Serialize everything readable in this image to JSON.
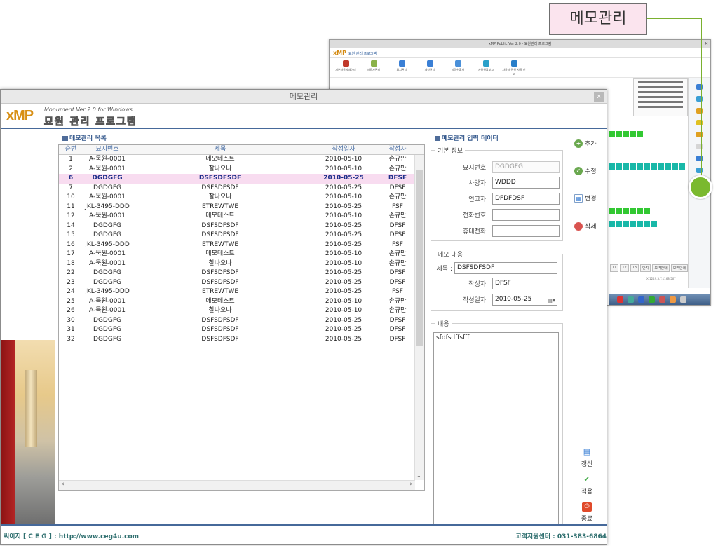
{
  "callout": {
    "label": "메모관리"
  },
  "bg_window": {
    "title": "xMP Public Ver 2.0 - 묘원관리 프로그램",
    "logo": "xMP",
    "logo_sub": "묘원 관리 프로그램",
    "toolbar": [
      {
        "label": "기본사용자데이터",
        "color": "#c0392b"
      },
      {
        "label": "사용자관리",
        "color": "#8bb24a"
      },
      {
        "label": "묘지관리",
        "color": "#3a7fd5"
      },
      {
        "label": "계약관리",
        "color": "#3a7fd5"
      },
      {
        "label": "지정현황서",
        "color": "#4a90d9"
      },
      {
        "label": "사용현황보고",
        "color": "#2aa0c9"
      },
      {
        "label": "사용자 권한 사용 신고",
        "color": "#2a7fc9"
      }
    ],
    "pager": [
      "11",
      "12",
      "13",
      "단지",
      "묘역안내",
      "묘역안내"
    ],
    "coord": "X:1249.3,Y:1168.567"
  },
  "window": {
    "title": "메모관리",
    "close": "x",
    "logo_x": "xMP",
    "logo_small": "Monument Ver 2.0 for Windows",
    "logo_name": "묘원 관리 프로그램"
  },
  "list": {
    "title": "메모관리 목록",
    "headers": [
      "순번",
      "묘지번호",
      "제목",
      "작성일자",
      "작성자"
    ],
    "rows": [
      [
        "1",
        "A-묵원-0001",
        "메모테스트",
        "2010-05-10",
        "손규만"
      ],
      [
        "2",
        "A-묵원-0001",
        "찰나오나",
        "2010-05-10",
        "손규만"
      ],
      [
        "6",
        "DGDGFG",
        "DSFSDFSDF",
        "2010-05-25",
        "DFSF"
      ],
      [
        "7",
        "DGDGFG",
        "DSFSDFSDF",
        "2010-05-25",
        "DFSF"
      ],
      [
        "10",
        "A-묵원-0001",
        "찰나오나",
        "2010-05-10",
        "손규만"
      ],
      [
        "11",
        "JKL-3495-DDD",
        "ETREWTWE",
        "2010-05-25",
        "FSF"
      ],
      [
        "12",
        "A-묵원-0001",
        "메모테스트",
        "2010-05-10",
        "손규만"
      ],
      [
        "14",
        "DGDGFG",
        "DSFSDFSDF",
        "2010-05-25",
        "DFSF"
      ],
      [
        "15",
        "DGDGFG",
        "DSFSDFSDF",
        "2010-05-25",
        "DFSF"
      ],
      [
        "16",
        "JKL-3495-DDD",
        "ETREWTWE",
        "2010-05-25",
        "FSF"
      ],
      [
        "17",
        "A-묵원-0001",
        "메모테스트",
        "2010-05-10",
        "손규만"
      ],
      [
        "18",
        "A-묵원-0001",
        "찰나오나",
        "2010-05-10",
        "손규만"
      ],
      [
        "22",
        "DGDGFG",
        "DSFSDFSDF",
        "2010-05-25",
        "DFSF"
      ],
      [
        "23",
        "DGDGFG",
        "DSFSDFSDF",
        "2010-05-25",
        "DFSF"
      ],
      [
        "24",
        "JKL-3495-DDD",
        "ETREWTWE",
        "2010-05-25",
        "FSF"
      ],
      [
        "25",
        "A-묵원-0001",
        "메모테스트",
        "2010-05-10",
        "손규만"
      ],
      [
        "26",
        "A-묵원-0001",
        "찰나오나",
        "2010-05-10",
        "손규만"
      ],
      [
        "30",
        "DGDGFG",
        "DSFSDFSDF",
        "2010-05-25",
        "DFSF"
      ],
      [
        "31",
        "DGDGFG",
        "DSFSDFSDF",
        "2010-05-25",
        "DFSF"
      ],
      [
        "32",
        "DGDGFG",
        "DSFSDFSDF",
        "2010-05-25",
        "DFSF"
      ]
    ],
    "selected_index": 2
  },
  "form": {
    "title": "메모관리 입력 데이터",
    "basic": {
      "label": "기본 정보",
      "grave_no_label": "묘지번호 :",
      "grave_no_value": "DGDGFG",
      "deceased_label": "사망자 :",
      "deceased_value": "WDDD",
      "relative_label": "연고자 :",
      "relative_value": "DFDFDSF",
      "phone_label": "전화번호 :",
      "phone_value": "",
      "mobile_label": "휴대전화 :",
      "mobile_value": ""
    },
    "memo": {
      "label": "메모 내용",
      "title_label": "제목 :",
      "title_value": "DSFSDFSDF",
      "writer_label": "작성자 :",
      "writer_value": "DFSF",
      "date_label": "작성일자 :",
      "date_value": "2010-05-25"
    },
    "content": {
      "label": "내용",
      "value": "sfdfsdffsfff'"
    }
  },
  "actions": {
    "add": "추가",
    "edit": "수정",
    "change": "변경",
    "delete": "삭제",
    "refresh": "갱신",
    "apply": "적용",
    "close": "종료"
  },
  "footer": {
    "left": "씨이지 [ C E G ] : http://www.ceg4u.com",
    "right": "고객지원센터 : 031-383-6864"
  },
  "colors": {
    "accent": "#46699a",
    "selected_row": "#f8dcf0",
    "logo_orange": "#d89016",
    "callout_bg": "#fbe4ee",
    "marker_green": "#7ab92f"
  }
}
